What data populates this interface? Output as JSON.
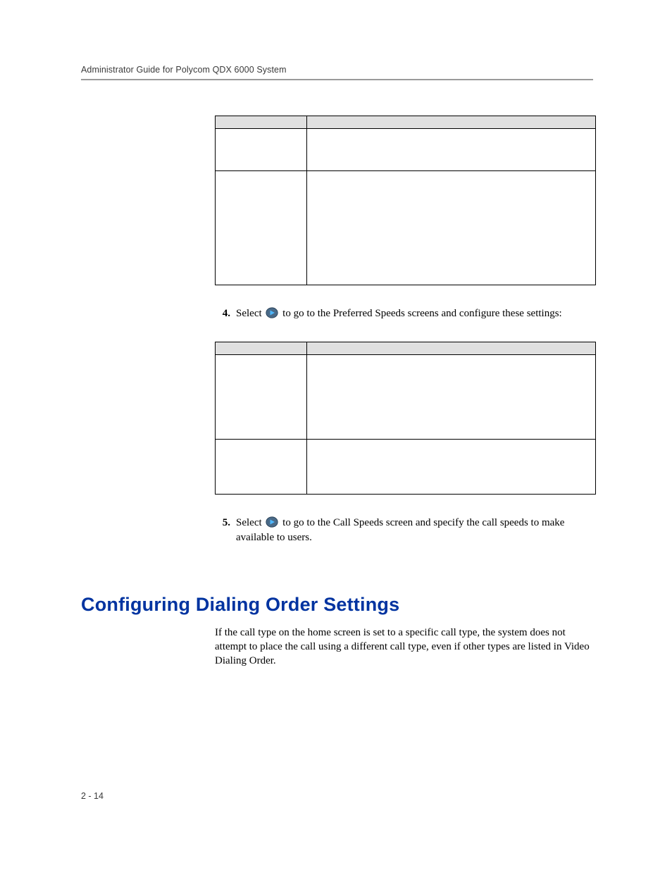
{
  "header": {
    "running_title": "Administrator Guide for Polycom QDX 6000 System"
  },
  "table1": {
    "head": {
      "setting": "",
      "description": ""
    },
    "rows": [
      {
        "setting": "",
        "description": ""
      },
      {
        "setting": "",
        "description": ""
      }
    ]
  },
  "step4": {
    "number": "4.",
    "lead": "Select",
    "tail": "to go to the Preferred Speeds screens and configure these settings:"
  },
  "table2": {
    "head": {
      "setting": "",
      "description": ""
    },
    "rows": [
      {
        "setting": "",
        "description": ""
      },
      {
        "setting": "",
        "description": ""
      }
    ]
  },
  "step5": {
    "number": "5.",
    "lead": "Select",
    "tail": "to go to the Call Speeds screen and specify the call speeds to make available to users."
  },
  "section": {
    "heading": "Configuring Dialing Order Settings",
    "para": "If the call type on the home screen is set to a specific call type, the system does not attempt to place the call using a different call type, even if other types are listed in Video Dialing Order."
  },
  "footer": {
    "page_number": "2 - 14"
  }
}
